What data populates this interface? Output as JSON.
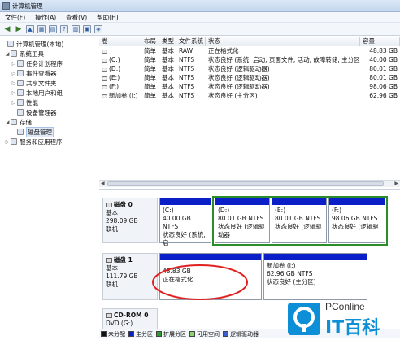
{
  "window": {
    "title": "计算机管理"
  },
  "menu": [
    "文件(F)",
    "操作(A)",
    "查看(V)",
    "帮助(H)"
  ],
  "tree": [
    {
      "label": "计算机管理(本地)",
      "level": 0,
      "expander": ""
    },
    {
      "label": "系统工具",
      "level": 1,
      "expander": "◢"
    },
    {
      "label": "任务计划程序",
      "level": 2,
      "expander": "▷"
    },
    {
      "label": "事件查看器",
      "level": 2,
      "expander": "▷"
    },
    {
      "label": "共享文件夹",
      "level": 2,
      "expander": "▷"
    },
    {
      "label": "本地用户和组",
      "level": 2,
      "expander": "▷"
    },
    {
      "label": "性能",
      "level": 2,
      "expander": "▷"
    },
    {
      "label": "设备管理器",
      "level": 2,
      "expander": ""
    },
    {
      "label": "存储",
      "level": 1,
      "expander": "◢"
    },
    {
      "label": "磁盘管理",
      "level": 2,
      "expander": ""
    },
    {
      "label": "服务和应用程序",
      "level": 1,
      "expander": "▷"
    }
  ],
  "volume_table": {
    "headers": [
      "卷",
      "布局",
      "类型",
      "文件系统",
      "状态",
      "容量"
    ],
    "rows": [
      [
        "",
        "简单",
        "基本",
        "RAW",
        "正在格式化",
        "48.83 GB"
      ],
      [
        "(C:)",
        "简单",
        "基本",
        "NTFS",
        "状态良好 (系统, 启动, 页面文件, 活动, 故障转储, 主分区)",
        "40.00 GB"
      ],
      [
        "(D:)",
        "简单",
        "基本",
        "NTFS",
        "状态良好 (逻辑驱动器)",
        "80.01 GB"
      ],
      [
        "(E:)",
        "简单",
        "基本",
        "NTFS",
        "状态良好 (逻辑驱动器)",
        "80.01 GB"
      ],
      [
        "(F:)",
        "简单",
        "基本",
        "NTFS",
        "状态良好 (逻辑驱动器)",
        "98.06 GB"
      ],
      [
        "新加卷 (I:)",
        "简单",
        "基本",
        "NTFS",
        "状态良好 (主分区)",
        "62.96 GB"
      ]
    ]
  },
  "disks": [
    {
      "name": "磁盘 0",
      "type": "基本",
      "size": "298.09 GB",
      "status": "联机",
      "partitions": [
        {
          "name": "(C:)",
          "size": "40.00 GB NTFS",
          "status": "状态良好 (系统, 启"
        },
        {
          "name": "(D:)",
          "size": "80.01 GB NTFS",
          "status": "状态良好 (逻辑驱动器"
        },
        {
          "name": "(E:)",
          "size": "80.01 GB NTFS",
          "status": "状态良好 (逻辑驱"
        },
        {
          "name": "(F:)",
          "size": "98.06 GB NTFS",
          "status": "状态良好 (逻辑驱"
        }
      ]
    },
    {
      "name": "磁盘 1",
      "type": "基本",
      "size": "111.79 GB",
      "status": "联机",
      "partitions": [
        {
          "name": "",
          "size": "48.83 GB",
          "status": "正在格式化"
        },
        {
          "name": "新加卷 (I:)",
          "size": "62.96 GB NTFS",
          "status": "状态良好 (主分区)"
        }
      ]
    },
    {
      "name": "CD-ROM 0",
      "type": "DVD (G:)",
      "size": "",
      "status": ""
    }
  ],
  "legend": [
    {
      "label": "未分配",
      "color": "#111111"
    },
    {
      "label": "主分区",
      "color": "#0a1fc8"
    },
    {
      "label": "扩展分区",
      "color": "#2e9b2e"
    },
    {
      "label": "可用空间",
      "color": "#8fd36e"
    },
    {
      "label": "逻辑驱动器",
      "color": "#3b5fd6"
    }
  ],
  "watermark": {
    "brand": "PConline",
    "name": "IT百科"
  }
}
